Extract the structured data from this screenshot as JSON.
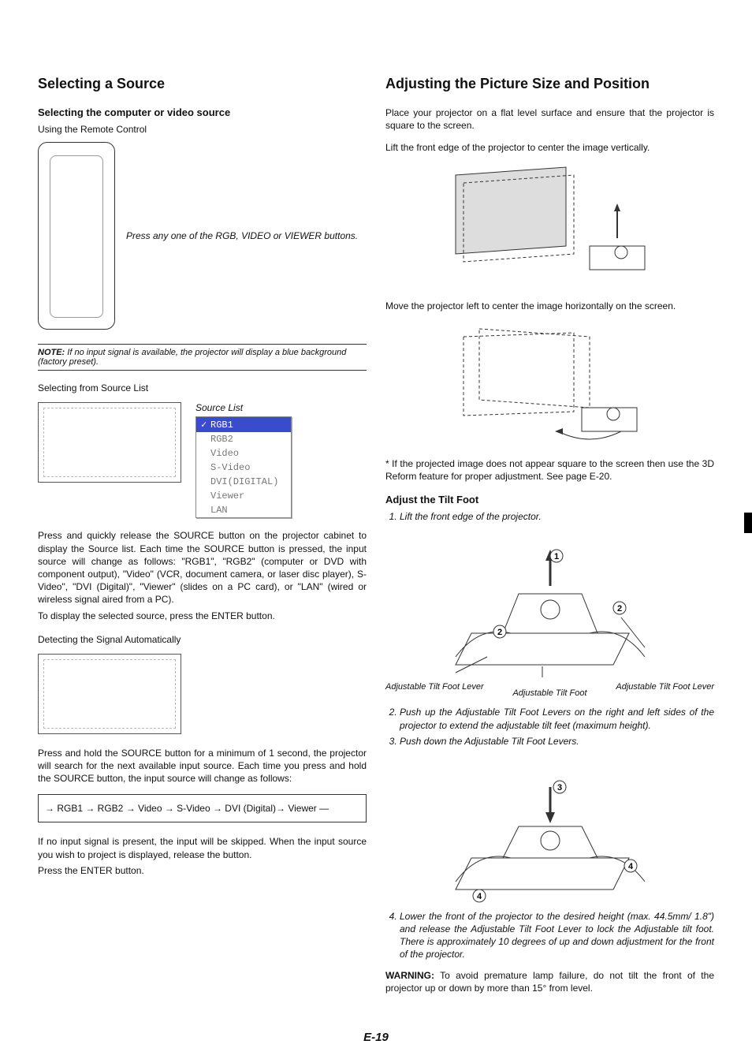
{
  "page_number": "E-19",
  "left": {
    "heading": "Selecting a Source",
    "subheading": "Selecting the computer or video source",
    "using_remote": "Using the Remote Control",
    "remote_caption": "Press any one of the RGB, VIDEO or VIEWER buttons.",
    "note_label": "NOTE:",
    "note_text": " If no input signal is available, the projector will display a blue background (factory preset).",
    "selecting_from_list": "Selecting from Source List",
    "source_list_title": "Source List",
    "source_items": [
      "RGB1",
      "RGB2",
      "Video",
      "S-Video",
      "DVI(DIGITAL)",
      "Viewer",
      "LAN"
    ],
    "source_selected_index": 0,
    "para_source_cycle": "Press and quickly release the SOURCE button on the projector cabinet to display the Source list. Each time the SOURCE button is pressed, the input source will change as follows: \"RGB1\", \"RGB2\" (computer or DVD with component output), \"Video\" (VCR, document camera, or laser disc player), S-Video\", \"DVI (Digital)\", \"Viewer\" (slides on a PC card), or \"LAN\" (wired or wireless signal aired from a PC).",
    "para_display_selected": "To display the selected source, press the ENTER button.",
    "detect_auto_heading": "Detecting the Signal Automatically",
    "para_hold_source": "Press and hold the SOURCE button for a minimum of 1 second, the projector will search for the next available input source. Each time you press and hold the SOURCE button, the input source will change as follows:",
    "sequence_line": "→ RGB1 → RGB2 → Video → S-Video → DVI (Digital)→ Viewer —",
    "para_no_signal": "If no input signal is present, the input will be skipped. When the input source you wish to project is displayed, release the button.",
    "para_press_enter": "Press the ENTER button."
  },
  "right": {
    "heading": "Adjusting the Picture Size and Position",
    "para_place": "Place your projector on a flat level surface and ensure that the projector is square to the screen.",
    "para_lift": "Lift the front edge of the projector to center the image vertically.",
    "para_move_left": "Move the projector left to center the image horizontally on the screen.",
    "para_3dreform": "* If the projected image does not appear square to the screen then use the 3D Reform feature for proper adjustment. See page E-20.",
    "adjust_tilt_heading": "Adjust the Tilt Foot",
    "step1": "Lift the front edge of the projector.",
    "label_left_lever": "Adjustable Tilt Foot Lever",
    "label_right_lever": "Adjustable Tilt Foot Lever",
    "label_foot": "Adjustable Tilt Foot",
    "step2": "Push up the Adjustable Tilt Foot Levers on the right and left sides of the projector to extend the adjustable tilt feet (maximum height).",
    "step3": "Push down the Adjustable Tilt Foot Levers.",
    "step4": "Lower the front of the projector to the desired height (max. 44.5mm/ 1.8\") and release the Adjustable Tilt Foot Lever to lock the Adjustable tilt foot. There is approximately 10 degrees of up and down adjustment for the front of the projector.",
    "warning_label": "WARNING:",
    "warning_text": " To avoid premature lamp failure, do not tilt the front of the projector up or down by more than 15° from level."
  }
}
